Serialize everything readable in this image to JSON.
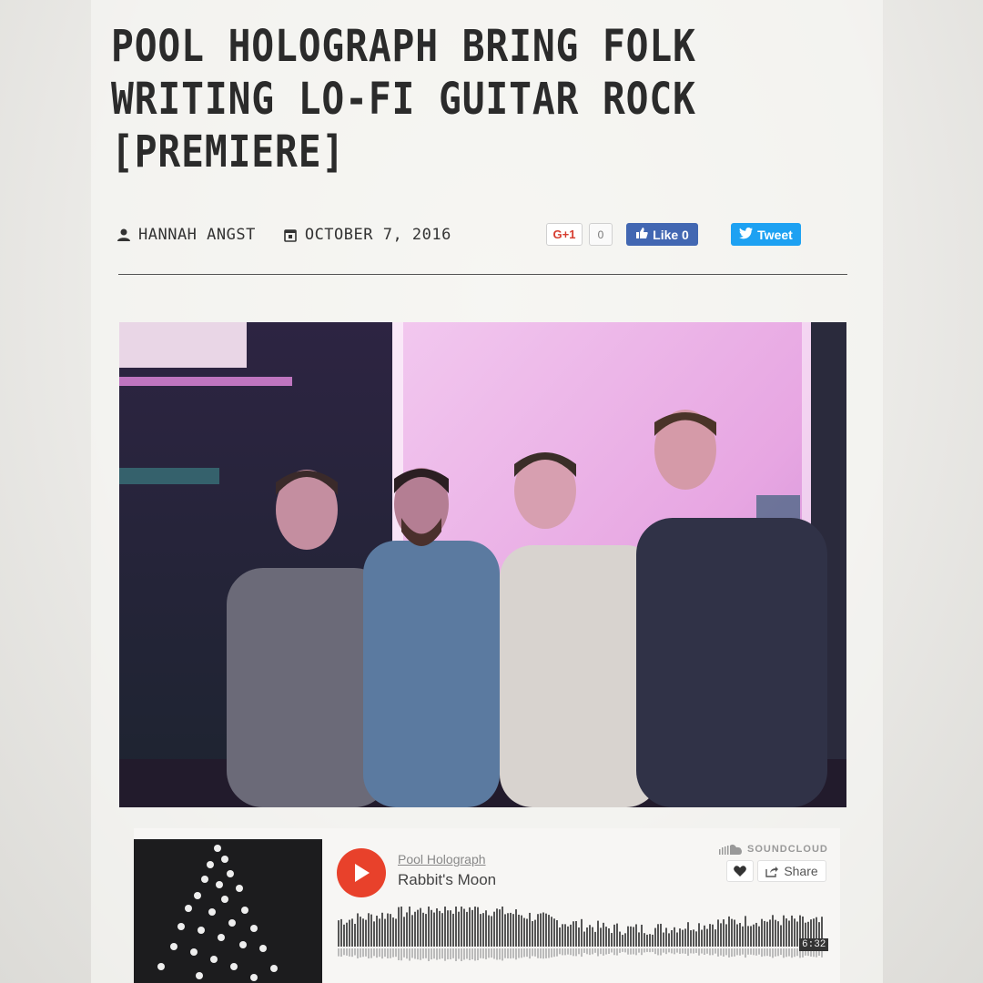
{
  "article": {
    "headline_lines": [
      "POOL HOLOGRAPH BRING FOLK",
      "WRITING LO-FI GUITAR ROCK",
      "[PREMIERE]"
    ],
    "author": "HANNAH ANGST",
    "date": "OCTOBER 7, 2016",
    "icons": {
      "author": "user-icon",
      "date": "calendar-icon"
    }
  },
  "social": {
    "gplus_label": "G+1",
    "gplus_count": "0",
    "fb_label": "Like 0",
    "tweet_label": "Tweet",
    "colors": {
      "facebook": "#4267b2",
      "twitter": "#1da1f2",
      "gplus": "#d63c2f"
    }
  },
  "photo": {
    "description_icon": "band-photo",
    "accent": "#e06fd0"
  },
  "player": {
    "artist": "Pool Holograph",
    "track": "Rabbit's Moon",
    "brand": "SOUNDCLOUD",
    "share_label": "Share",
    "duration": "6:32",
    "colors": {
      "play": "#e8412b"
    }
  }
}
